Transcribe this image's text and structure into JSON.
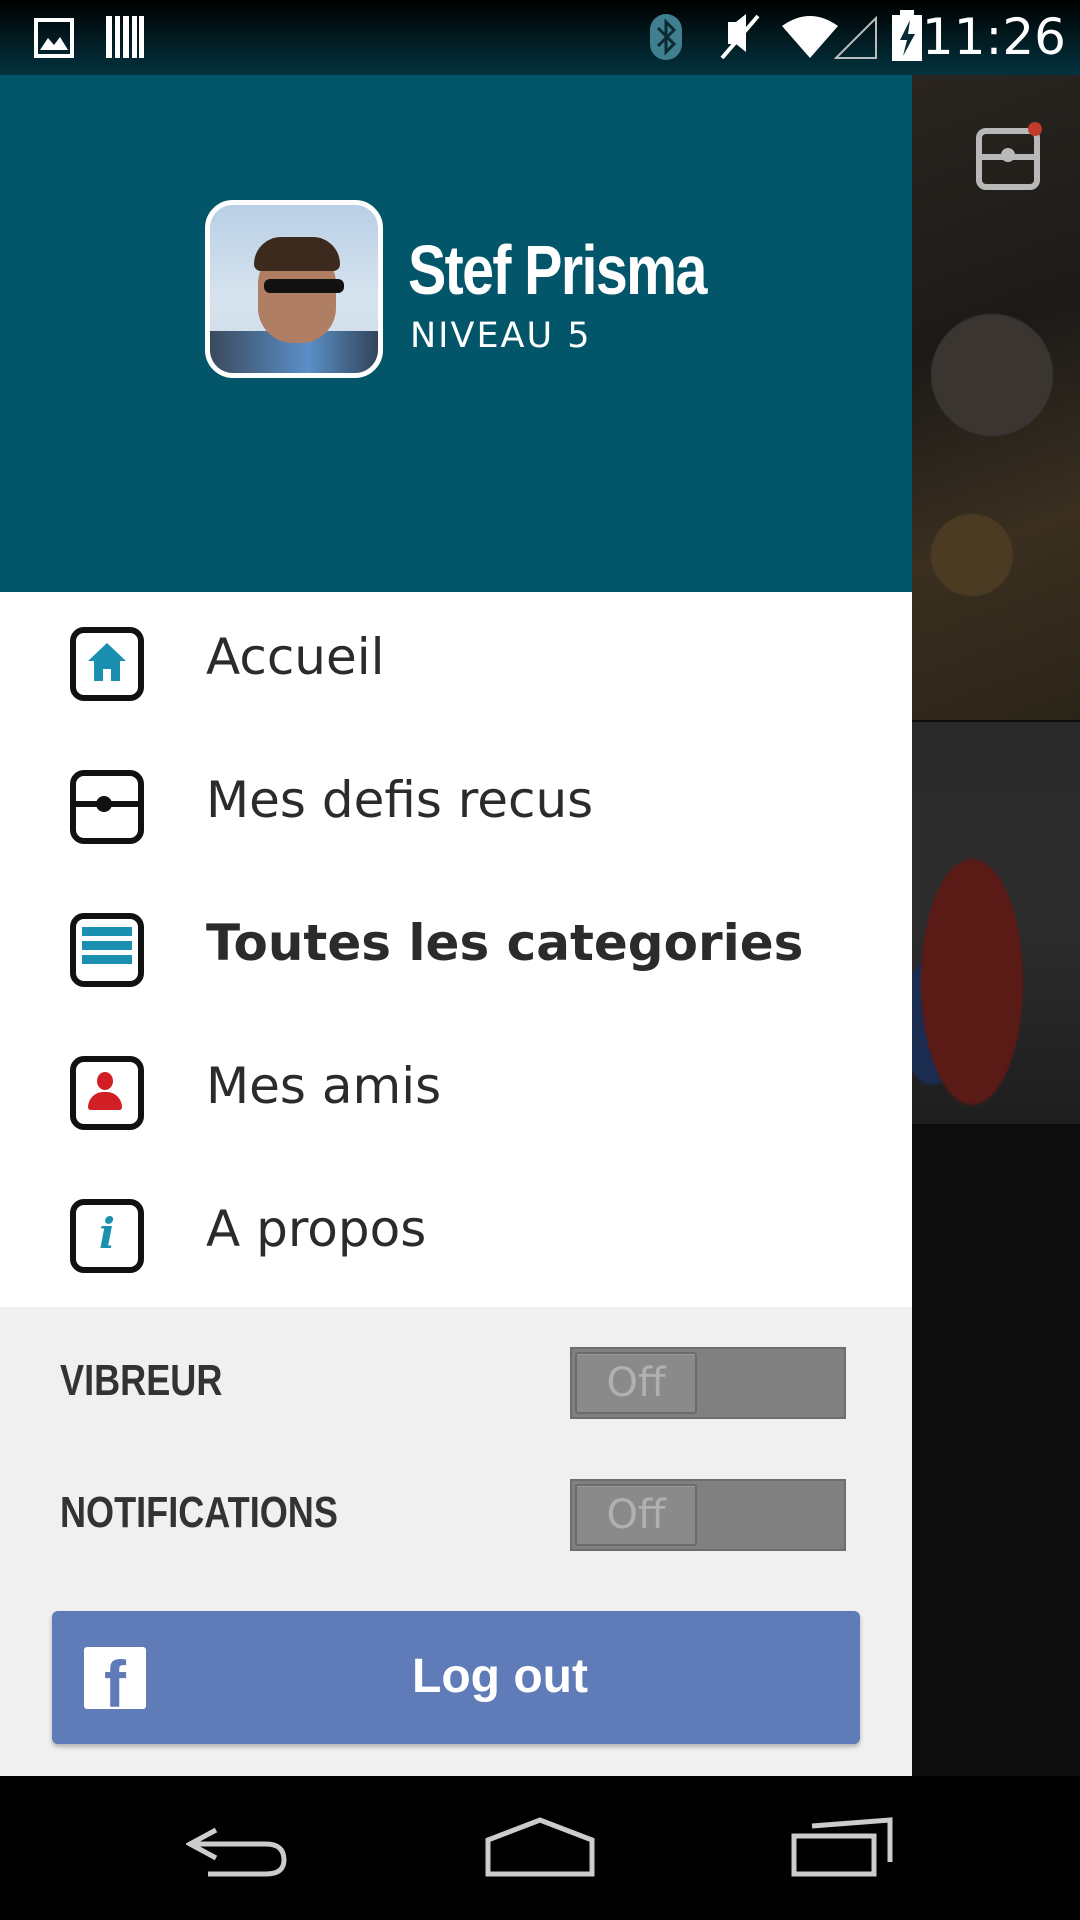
{
  "status_bar": {
    "time": "11:26",
    "icons": [
      "image-icon",
      "barcode-icon",
      "bluetooth-icon",
      "mute-icon",
      "wifi-icon",
      "signal-icon",
      "battery-charging-icon"
    ]
  },
  "drawer": {
    "user": {
      "name": "Stef Prisma",
      "level": "NIVEAU 5"
    },
    "menu": [
      {
        "label": "Accueil",
        "icon": "home-icon",
        "bold": false
      },
      {
        "label": "Mes defis recus",
        "icon": "challenge-icon",
        "bold": false
      },
      {
        "label": "Toutes les categories",
        "icon": "categories-icon",
        "bold": true
      },
      {
        "label": "Mes amis",
        "icon": "friends-icon",
        "bold": false
      },
      {
        "label": "A propos",
        "icon": "info-icon",
        "bold": false
      }
    ],
    "settings": {
      "vibreur": {
        "label": "VIBREUR",
        "state": "Off"
      },
      "notifications": {
        "label": "NOTIFICATIONS",
        "state": "Off"
      }
    },
    "logout": {
      "label": "Log out",
      "icon": "facebook-icon"
    }
  },
  "colors": {
    "header": "#035569",
    "accent": "#1a8fb0",
    "friends_icon": "#d21f26",
    "facebook": "#5f7bb8"
  },
  "nav_bar": {
    "buttons": [
      "back-icon",
      "home-icon",
      "recent-apps-icon"
    ]
  }
}
